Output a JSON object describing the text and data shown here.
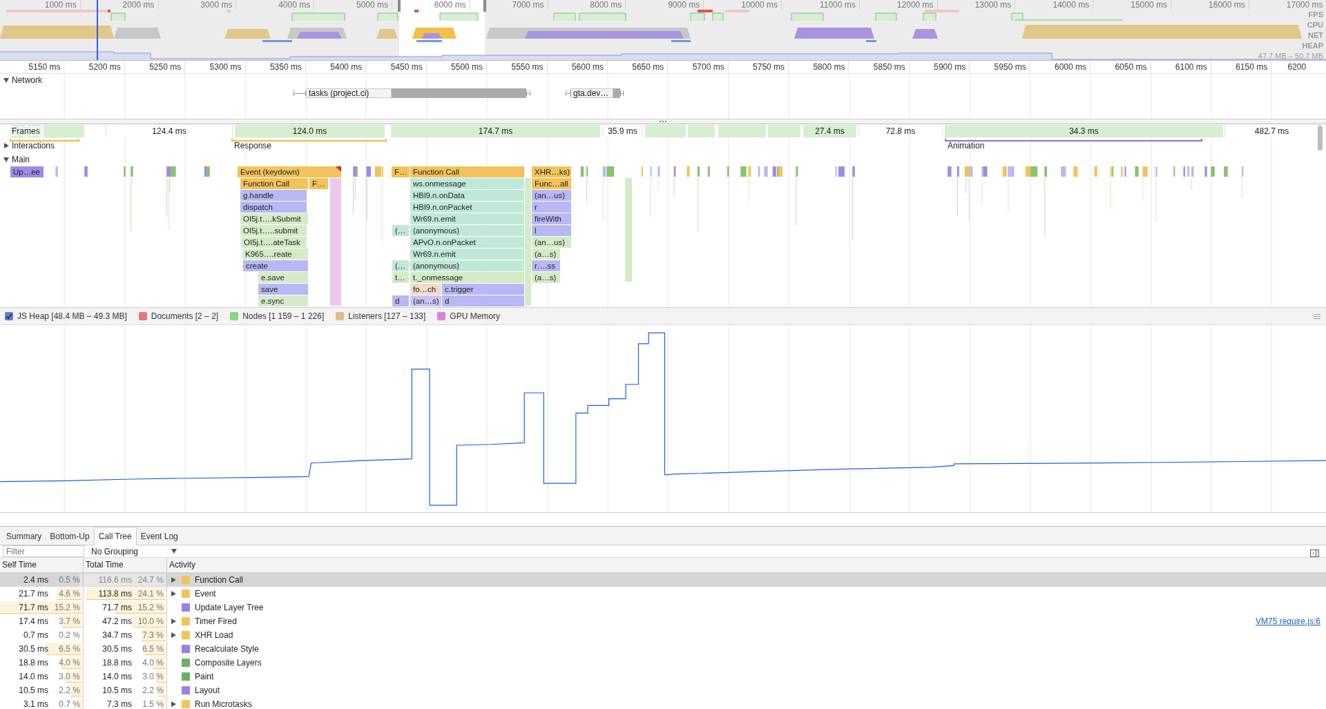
{
  "overview": {
    "ticks": [
      "1000 ms",
      "2000 ms",
      "3000 ms",
      "4000 ms",
      "5000 ms",
      "6000 ms",
      "7000 ms",
      "8000 ms",
      "9000 ms",
      "10000 ms",
      "11000 ms",
      "12000 ms",
      "13000 ms",
      "14000 ms",
      "15000 ms",
      "16000 ms",
      "17000 ms"
    ],
    "tracks": [
      "FPS",
      "CPU",
      "NET",
      "HEAP"
    ],
    "heap_range": "47.7 MB – 50.7 MB"
  },
  "ruler": {
    "ticks": [
      "5150 ms",
      "5200 ms",
      "5250 ms",
      "5300 ms",
      "5350 ms",
      "5400 ms",
      "5450 ms",
      "5500 ms",
      "5550 ms",
      "5600 ms",
      "5650 ms",
      "5700 ms",
      "5750 ms",
      "5800 ms",
      "5850 ms",
      "5900 ms",
      "5950 ms",
      "6000 ms",
      "6050 ms",
      "6100 ms",
      "6150 ms",
      "6200"
    ]
  },
  "network": {
    "title": "Network",
    "expanded": true,
    "requests": [
      {
        "label": "tasks (project.ci)"
      },
      {
        "label": "gta.dev…"
      }
    ]
  },
  "frames": {
    "title": "Frames",
    "items": [
      {
        "label": "124.4 ms",
        "kind": "idle"
      },
      {
        "label": "124.0 ms",
        "kind": "drawn"
      },
      {
        "label": "174.7 ms",
        "kind": "drawn"
      },
      {
        "label": "35.9 ms",
        "kind": "idle"
      },
      {
        "label": "27.4 ms",
        "kind": "drawn"
      },
      {
        "label": "72.8 ms",
        "kind": "idle"
      },
      {
        "label": "34.3 ms",
        "kind": "drawn"
      },
      {
        "label": "482.7 ms",
        "kind": "idle"
      }
    ]
  },
  "interactions": {
    "title": "Interactions",
    "expanded": false,
    "items": [
      {
        "label": "Response",
        "color": "#f0b840"
      },
      {
        "label": "Animation",
        "color": "#8a6fe0"
      }
    ]
  },
  "main": {
    "title": "Main",
    "expanded": true,
    "blocks": [
      {
        "label": "Up…ee",
        "color": "#9f8ae6"
      },
      {
        "label": "Event (keydown)",
        "color": "#f2c35a",
        "warning": true
      },
      {
        "label": "F…",
        "color": "#f2c35a"
      },
      {
        "label": "Function Call",
        "color": "#f2c35a"
      },
      {
        "label": "XHR…ks)",
        "color": "#f2c35a"
      },
      {
        "label": "Function Call",
        "color": "#f2c35a"
      },
      {
        "label": "F…",
        "color": "#f2c35a"
      },
      {
        "label": "ws.onmessage",
        "color": "#c0e8d8"
      },
      {
        "label": "Func…all",
        "color": "#f2c35a"
      },
      {
        "label": "g.handle",
        "color": "#b8b8f4"
      },
      {
        "label": "HBl9.n.onData",
        "color": "#c0e8d8"
      },
      {
        "label": "(an…us)",
        "color": "#b8b8f4"
      },
      {
        "label": "dispatch",
        "color": "#b8b8f4"
      },
      {
        "label": "HBl9.n.onPacket",
        "color": "#c0e8d8"
      },
      {
        "label": "r",
        "color": "#b8b8f4"
      },
      {
        "label": "OI5j.t….kSubmit",
        "color": "#d4ebc8"
      },
      {
        "label": "Wr69.n.emit",
        "color": "#c0e8d8"
      },
      {
        "label": "fireWith",
        "color": "#b8b8f4"
      },
      {
        "label": "OI5j.t…..submit",
        "color": "#d4ebc8"
      },
      {
        "label": "(…",
        "color": "#c0e8d8"
      },
      {
        "label": "(anonymous)",
        "color": "#c0e8d8"
      },
      {
        "label": "l",
        "color": "#b8b8f4"
      },
      {
        "label": "OI5j.t….ateTask",
        "color": "#d4ebc8"
      },
      {
        "label": "APvO.n.onPacket",
        "color": "#c0e8d8"
      },
      {
        "label": "(an…us)",
        "color": "#d4ebc8"
      },
      {
        "label": "K965….reate",
        "color": "#d4ebc8"
      },
      {
        "label": "Wr69.n.emit",
        "color": "#c0e8d8"
      },
      {
        "label": "(a…s)",
        "color": "#d4ebc8"
      },
      {
        "label": "create",
        "color": "#b8b8f4"
      },
      {
        "label": "(…",
        "color": "#c0e8d8"
      },
      {
        "label": "(anonymous)",
        "color": "#c0e8d8"
      },
      {
        "label": "r….ss",
        "color": "#b8b8f4"
      },
      {
        "label": "e.save",
        "color": "#d4ebc8"
      },
      {
        "label": "t…",
        "color": "#d4ebc8"
      },
      {
        "label": "t._onmessage",
        "color": "#d4ebc8"
      },
      {
        "label": "(a…s)",
        "color": "#d4ebc8"
      },
      {
        "label": "save",
        "color": "#b8b8f4"
      },
      {
        "label": "fo…ch",
        "color": "#f3d9c6"
      },
      {
        "label": "c.trigger",
        "color": "#b8b8f4"
      },
      {
        "label": "e.sync",
        "color": "#d4ebc8"
      },
      {
        "label": "d",
        "color": "#b8b8f4"
      },
      {
        "label": "(an…s)",
        "color": "#c8c4f4"
      },
      {
        "label": "d",
        "color": "#b8b8f4"
      }
    ]
  },
  "memory": {
    "legend": [
      {
        "label": "JS Heap [48.4 MB – 49.3 MB]",
        "checked": true,
        "color": "#5f7fd6"
      },
      {
        "label": "Documents [2 – 2]",
        "checked": false,
        "color": "#e07b78"
      },
      {
        "label": "Nodes [1 159 – 1 226]",
        "checked": false,
        "color": "#86d886"
      },
      {
        "label": "Listeners [127 – 133]",
        "checked": false,
        "color": "#e2bc84"
      },
      {
        "label": "GPU Memory",
        "checked": false,
        "color": "#e07ee0"
      }
    ]
  },
  "details": {
    "tabs": [
      {
        "label": "Summary",
        "selected": false
      },
      {
        "label": "Bottom-Up",
        "selected": false
      },
      {
        "label": "Call Tree",
        "selected": true
      },
      {
        "label": "Event Log",
        "selected": false
      }
    ],
    "filter": {
      "placeholder": "Filter"
    },
    "grouping": "No Grouping",
    "columns": [
      "Self Time",
      "Total Time",
      "Activity"
    ],
    "rows": [
      {
        "self": {
          "time": "2.4 ms",
          "percent": "0.5 %",
          "level": 0.03
        },
        "total": {
          "time": "116.6 ms",
          "percent": "24.7 %",
          "level": 0.99
        },
        "activity": "Function Call",
        "color": "#f2c35a",
        "expandable": true,
        "selected": true
      },
      {
        "self": {
          "time": "21.7 ms",
          "percent": "4.6 %",
          "level": 0.3
        },
        "total": {
          "time": "113.8 ms",
          "percent": "24.1 %",
          "level": 0.96
        },
        "activity": "Event",
        "color": "#f2c35a",
        "expandable": true,
        "selected": false
      },
      {
        "self": {
          "time": "71.7 ms",
          "percent": "15.2 %",
          "level": 1
        },
        "total": {
          "time": "71.7 ms",
          "percent": "15.2 %",
          "level": 0.61
        },
        "activity": "Update Layer Tree",
        "color": "#9b80e6",
        "expandable": false,
        "selected": false
      },
      {
        "self": {
          "time": "17.4 ms",
          "percent": "3.7 %",
          "level": 0.24
        },
        "total": {
          "time": "47.2 ms",
          "percent": "10.0 %",
          "level": 0.4
        },
        "activity": "Timer Fired",
        "color": "#f2c35a",
        "expandable": true,
        "selected": false,
        "source": "VM75 require.js:6"
      },
      {
        "self": {
          "time": "0.7 ms",
          "percent": "0.2 %",
          "level": 0.01
        },
        "total": {
          "time": "34.7 ms",
          "percent": "7.3 %",
          "level": 0.29
        },
        "activity": "XHR Load",
        "color": "#f2c35a",
        "expandable": true,
        "selected": false
      },
      {
        "self": {
          "time": "30.5 ms",
          "percent": "6.5 %",
          "level": 0.43
        },
        "total": {
          "time": "30.5 ms",
          "percent": "6.5 %",
          "level": 0.26
        },
        "activity": "Recalculate Style",
        "color": "#9b80e6",
        "expandable": false,
        "selected": false
      },
      {
        "self": {
          "time": "18.8 ms",
          "percent": "4.0 %",
          "level": 0.26
        },
        "total": {
          "time": "18.8 ms",
          "percent": "4.0 %",
          "level": 0.16
        },
        "activity": "Composite Layers",
        "color": "#6cb062",
        "expandable": false,
        "selected": false
      },
      {
        "self": {
          "time": "14.0 ms",
          "percent": "3.0 %",
          "level": 0.2
        },
        "total": {
          "time": "14.0 ms",
          "percent": "3.0 %",
          "level": 0.12
        },
        "activity": "Paint",
        "color": "#6cb062",
        "expandable": false,
        "selected": false
      },
      {
        "self": {
          "time": "10.5 ms",
          "percent": "2.2 %",
          "level": 0.14
        },
        "total": {
          "time": "10.5 ms",
          "percent": "2.2 %",
          "level": 0.09
        },
        "activity": "Layout",
        "color": "#9b80e6",
        "expandable": false,
        "selected": false
      },
      {
        "self": {
          "time": "3.1 ms",
          "percent": "0.7 %",
          "level": 0.05
        },
        "total": {
          "time": "7.3 ms",
          "percent": "1.5 %",
          "level": 0.06
        },
        "activity": "Run Microtasks",
        "color": "#f2c35a",
        "expandable": true,
        "selected": false
      }
    ]
  }
}
